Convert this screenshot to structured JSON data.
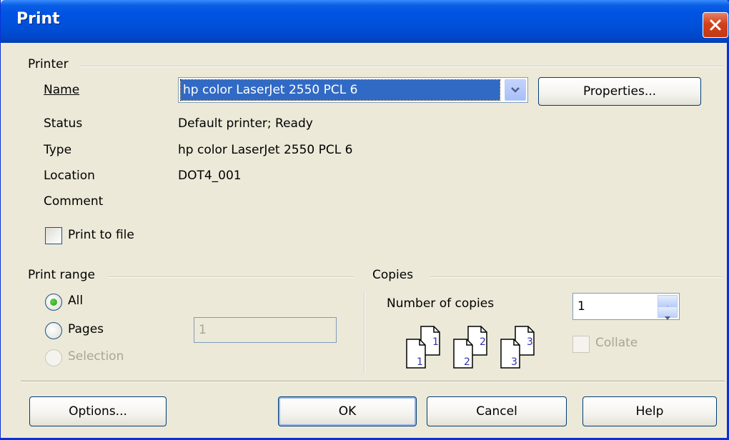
{
  "window": {
    "title": "Print"
  },
  "printer": {
    "group_label": "Printer",
    "name_label": "Name",
    "name_value": "hp color LaserJet 2550 PCL 6",
    "properties_button": "Properties...",
    "status_label": "Status",
    "status_value": "Default printer; Ready",
    "type_label": "Type",
    "type_value": "hp color LaserJet 2550 PCL 6",
    "location_label": "Location",
    "location_value": "DOT4_001",
    "comment_label": "Comment",
    "comment_value": "",
    "print_to_file_label": "Print to file",
    "print_to_file_checked": false
  },
  "print_range": {
    "group_label": "Print range",
    "all_label": "All",
    "pages_label": "Pages",
    "selection_label": "Selection",
    "selected": "All",
    "pages_value": "1"
  },
  "copies": {
    "group_label": "Copies",
    "number_label": "Number of copies",
    "number_value": "1",
    "collate_label": "Collate",
    "collate_checked": false,
    "collate_pages": [
      {
        "back": "1",
        "front": "1"
      },
      {
        "back": "2",
        "front": "2"
      },
      {
        "back": "3",
        "front": "3"
      }
    ]
  },
  "buttons": {
    "options": "Options...",
    "ok": "OK",
    "cancel": "Cancel",
    "help": "Help"
  },
  "colors": {
    "titlebar": "#0054e3",
    "dialog_bg": "#ece9d8",
    "selection": "#316ac5",
    "close": "#d1411a",
    "page_numbers": "#3333aa"
  }
}
